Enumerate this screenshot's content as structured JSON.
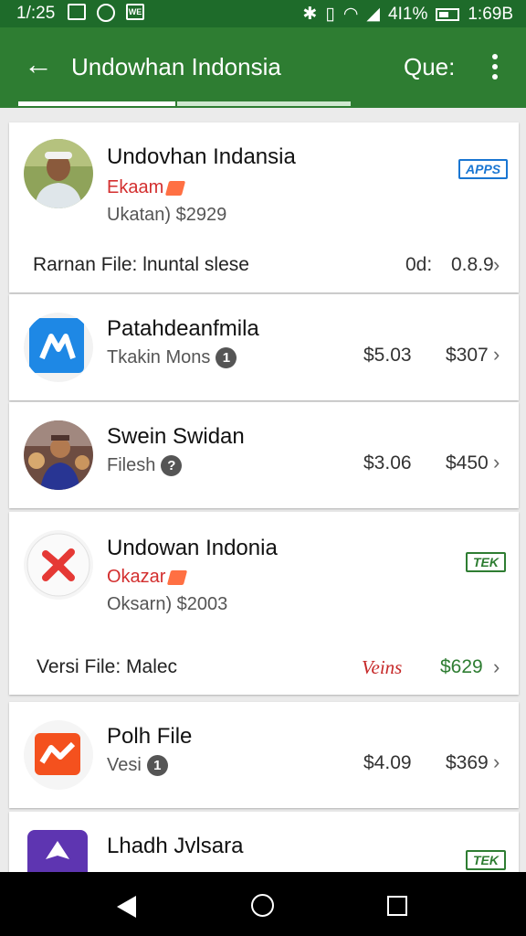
{
  "status_bar": {
    "time": "1/:25",
    "battery": "4I1%",
    "clock": "1:69B",
    "icon_sq2_text": "WE"
  },
  "app_bar": {
    "title": "Undowhan Indonsia",
    "query": "Que:"
  },
  "cards": [
    {
      "name": "Undovhan Indansia",
      "sub_red": "Ekaam",
      "sub_gray": "Ukatan)  $2929",
      "badge": "APPS",
      "file_label": "Rarnan File: lnuntal slese",
      "price1": "0d:",
      "price2": "0.8.9"
    },
    {
      "name": "Patahdeanfmila",
      "sub": "Tkakin Mons",
      "num": "1",
      "price1": "$5.03",
      "price2": "$307"
    },
    {
      "name": "Swein Swidan",
      "sub": "Filesh",
      "num": "?",
      "price1": "$3.06",
      "price2": "$450"
    },
    {
      "name": "Undowan Indonia",
      "sub_red": "Okazar",
      "sub_gray": "Oksarn)  $2003",
      "badge": "TEK",
      "file_label": "Versi   File: Malec",
      "price1": "Veins",
      "price2": "$629"
    },
    {
      "name": "Polh File",
      "sub": "Vesi",
      "num": "1",
      "price1": "$4.09",
      "price2": "$369"
    },
    {
      "name": "Lhadh Jvlsara",
      "badge": "TEK"
    }
  ],
  "colors": {
    "primary": "#2e7d32",
    "status": "#1e6b2a",
    "accent_red": "#d32f2f",
    "badge_blue": "#1976d2"
  },
  "icons": [
    "back-arrow-icon",
    "more-vert-icon",
    "chevron-right-icon",
    "nav-back-icon",
    "nav-home-icon",
    "nav-recent-icon"
  ]
}
